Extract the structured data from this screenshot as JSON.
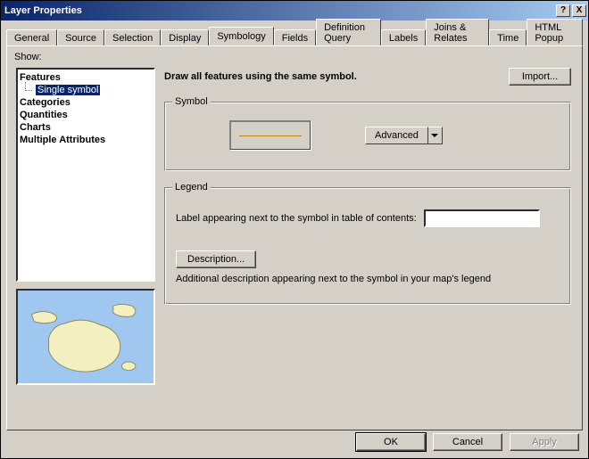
{
  "window": {
    "title": "Layer Properties"
  },
  "titlebar": {
    "help": "?",
    "close": "X"
  },
  "tabs": [
    "General",
    "Source",
    "Selection",
    "Display",
    "Symbology",
    "Fields",
    "Definition Query",
    "Labels",
    "Joins & Relates",
    "Time",
    "HTML Popup"
  ],
  "activeTab": "Symbology",
  "show": {
    "label": "Show:",
    "tree": {
      "features": "Features",
      "single_symbol": "Single symbol",
      "categories": "Categories",
      "quantities": "Quantities",
      "charts": "Charts",
      "multiple_attributes": "Multiple Attributes"
    }
  },
  "main": {
    "heading": "Draw all features using the same symbol.",
    "import": "Import...",
    "symbol": {
      "legend": "Symbol",
      "advanced": "Advanced"
    },
    "legend": {
      "legend": "Legend",
      "label_text": "Label appearing next to the symbol in table of contents:",
      "label_value": "",
      "description_btn": "Description...",
      "description_text": "Additional description appearing next to the symbol in your map's legend"
    }
  },
  "buttons": {
    "ok": "OK",
    "cancel": "Cancel",
    "apply": "Apply"
  }
}
